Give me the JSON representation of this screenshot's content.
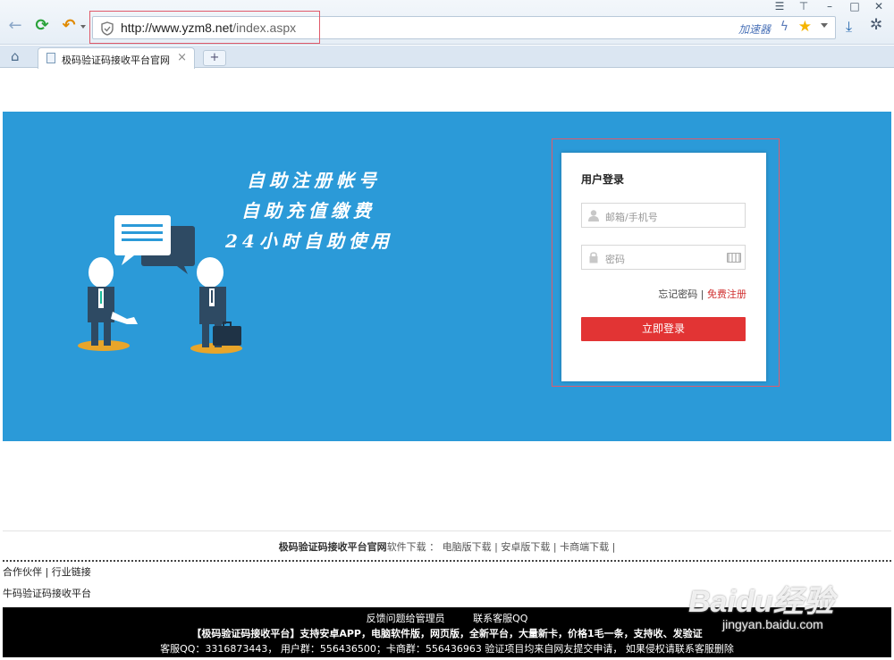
{
  "browser": {
    "url_host": "http://www.yzm8.net",
    "url_path": "/index.aspx",
    "accelerator_label": "加速器",
    "tab_title": "极码验证码接收平台官网",
    "new_tab_label": "+",
    "icons": [
      "back-arrow-icon",
      "refresh-icon",
      "undo-icon",
      "shield-icon",
      "bolt-icon",
      "star-icon",
      "download-icon",
      "settings-icon",
      "home-icon"
    ]
  },
  "banner": {
    "background": "#2b9ad8",
    "slogans": [
      "自助注册帐号",
      "自助充值缴费",
      "24小时自助使用"
    ]
  },
  "login": {
    "title": "用户登录",
    "username_placeholder": "邮箱/手机号",
    "password_placeholder": "密码",
    "forgot_label": "忘记密码",
    "separator": " | ",
    "register_label": "免费注册",
    "submit_label": "立即登录",
    "accent": "#e23434"
  },
  "downloads": {
    "site_label": "极码验证码接收平台官网",
    "prefix": "软件下载 ：",
    "pc": "电脑版下载",
    "android": "安卓版下载",
    "merchant": "卡商端下载"
  },
  "links": {
    "partners": "合作伙伴",
    "industry": "行业链接",
    "site_name": "牛码验证码接收平台"
  },
  "footer": {
    "feedback": "反馈问题给管理员",
    "contact": "联系客服QQ",
    "line2": "【极码验证码接收平台】支持安卓APP，电脑软件版，网页版，全新平台，大量新卡，价格1毛一条，支持收、发验证",
    "line3": "客服QQ：3316873443， 用户群：556436500；卡商群：556436963 验证项目均来自网友提交申请，  如果侵权请联系客服删除"
  },
  "watermark": {
    "brand": "Baidu经验",
    "domain": "jingyan.baidu.com"
  }
}
